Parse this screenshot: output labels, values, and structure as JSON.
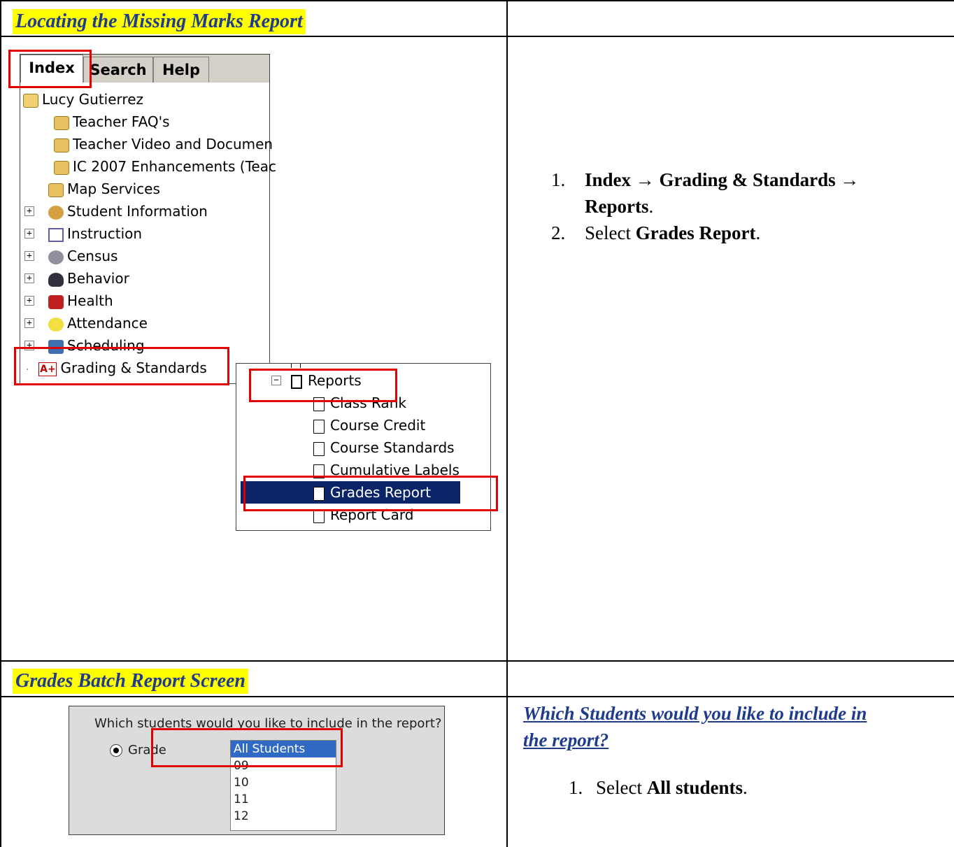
{
  "section1": {
    "heading": "Locating the Missing Marks Report",
    "tabs": [
      "Index",
      "Search",
      "Help"
    ],
    "tree": [
      {
        "label": "Lucy Gutierrez",
        "icon": "user-folder-icon"
      },
      {
        "label": "Teacher FAQ's",
        "icon": "folder-icon"
      },
      {
        "label": "Teacher Video and Documen",
        "icon": "folder-icon"
      },
      {
        "label": "IC 2007 Enhancements (Teac",
        "icon": "folder-icon"
      },
      {
        "label": "Map Services",
        "icon": "folder-icon"
      },
      {
        "label": "Student Information",
        "icon": "student-icon"
      },
      {
        "label": "Instruction",
        "icon": "instruction-icon"
      },
      {
        "label": "Census",
        "icon": "census-icon"
      },
      {
        "label": "Behavior",
        "icon": "behavior-icon"
      },
      {
        "label": "Health",
        "icon": "health-icon"
      },
      {
        "label": "Attendance",
        "icon": "attendance-icon"
      },
      {
        "label": "Scheduling",
        "icon": "scheduling-icon"
      },
      {
        "label": "Grading & Standards",
        "icon": "grading-icon",
        "icon_text": "A+"
      }
    ],
    "reports_tree": {
      "header": "Reports",
      "items": [
        "Class Rank",
        "Course Credit",
        "Course Standards",
        "Cumulative Labels",
        "Grades Report",
        "Report Card"
      ],
      "selected": "Grades Report"
    },
    "steps": {
      "step1_num": "1.",
      "step1_a": "Index",
      "step1_arrow1": "→",
      "step1_b": "Grading & Standards",
      "step1_arrow2": "→",
      "step1_c": "Reports",
      "step1_end": ".",
      "step2_num": "2.",
      "step2_pre": "Select ",
      "step2_bold": "Grades Report",
      "step2_end": "."
    }
  },
  "section2": {
    "heading": "Grades Batch Report Screen",
    "question_label": "Which students would you like to include in the report?",
    "radio_label": "Grade",
    "grade_options": [
      "All Students",
      "09",
      "10",
      "11",
      "12"
    ],
    "selected_option": "All Students",
    "right_heading_line1": "Which Students would you like to include in",
    "right_heading_line2": "the report?",
    "step1_num": "1.",
    "step1_pre": "Select ",
    "step1_bold": "All students",
    "step1_end": "."
  }
}
